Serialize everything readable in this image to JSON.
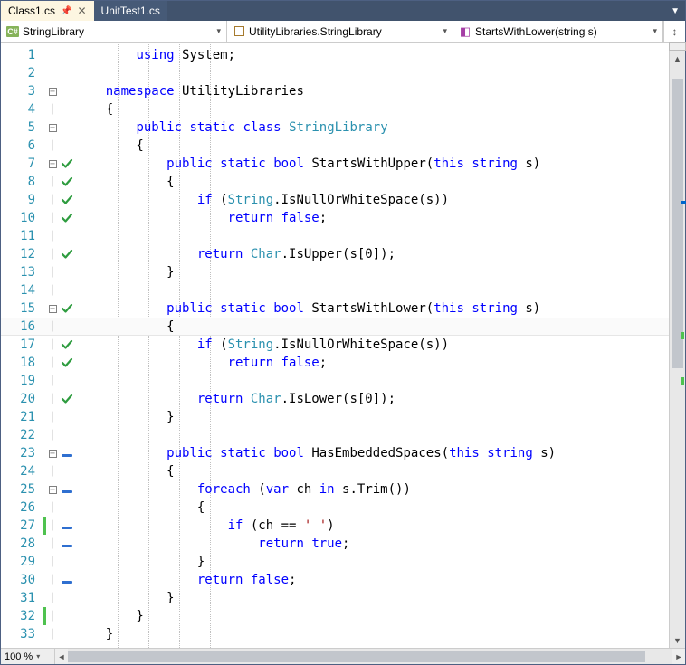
{
  "tabs": [
    {
      "label": "Class1.cs",
      "active": true
    },
    {
      "label": "UnitTest1.cs",
      "active": false
    }
  ],
  "nav": {
    "project": "StringLibrary",
    "class": "UtilityLibraries.StringLibrary",
    "member": "StartsWithLower(string s)"
  },
  "zoom": "100 %",
  "current_line": 16,
  "code": [
    {
      "n": 1,
      "fold": "",
      "mark": "",
      "chg": "",
      "tokens": [
        [
          "",
          "        "
        ],
        [
          "kw",
          "using"
        ],
        [
          "",
          " System;"
        ]
      ]
    },
    {
      "n": 2,
      "fold": "",
      "mark": "",
      "chg": "",
      "tokens": [
        [
          "",
          ""
        ]
      ]
    },
    {
      "n": 3,
      "fold": "box",
      "mark": "",
      "chg": "",
      "tokens": [
        [
          "",
          "    "
        ],
        [
          "kw",
          "namespace"
        ],
        [
          "",
          " UtilityLibraries"
        ]
      ]
    },
    {
      "n": 4,
      "fold": "",
      "mark": "",
      "chg": "",
      "tokens": [
        [
          "",
          "    {"
        ]
      ]
    },
    {
      "n": 5,
      "fold": "box",
      "mark": "",
      "chg": "",
      "tokens": [
        [
          "",
          "        "
        ],
        [
          "kw",
          "public"
        ],
        [
          "",
          " "
        ],
        [
          "kw",
          "static"
        ],
        [
          "",
          " "
        ],
        [
          "kw",
          "class"
        ],
        [
          "",
          " "
        ],
        [
          "type",
          "StringLibrary"
        ]
      ]
    },
    {
      "n": 6,
      "fold": "",
      "mark": "",
      "chg": "",
      "tokens": [
        [
          "",
          "        {"
        ]
      ]
    },
    {
      "n": 7,
      "fold": "box",
      "mark": "check",
      "chg": "",
      "tokens": [
        [
          "",
          "            "
        ],
        [
          "kw",
          "public"
        ],
        [
          "",
          " "
        ],
        [
          "kw",
          "static"
        ],
        [
          "",
          " "
        ],
        [
          "kw",
          "bool"
        ],
        [
          "",
          " StartsWithUpper("
        ],
        [
          "kw",
          "this"
        ],
        [
          "",
          " "
        ],
        [
          "kw",
          "string"
        ],
        [
          "",
          " s)"
        ]
      ]
    },
    {
      "n": 8,
      "fold": "",
      "mark": "check",
      "chg": "",
      "tokens": [
        [
          "",
          "            {"
        ]
      ]
    },
    {
      "n": 9,
      "fold": "",
      "mark": "check",
      "chg": "",
      "tokens": [
        [
          "",
          "                "
        ],
        [
          "kw",
          "if"
        ],
        [
          "",
          " ("
        ],
        [
          "type",
          "String"
        ],
        [
          "",
          ".IsNullOrWhiteSpace(s))"
        ]
      ]
    },
    {
      "n": 10,
      "fold": "",
      "mark": "check",
      "chg": "",
      "tokens": [
        [
          "",
          "                    "
        ],
        [
          "kw",
          "return"
        ],
        [
          "",
          " "
        ],
        [
          "kw",
          "false"
        ],
        [
          "",
          ";"
        ]
      ]
    },
    {
      "n": 11,
      "fold": "",
      "mark": "",
      "chg": "",
      "tokens": [
        [
          "",
          ""
        ]
      ]
    },
    {
      "n": 12,
      "fold": "",
      "mark": "check",
      "chg": "",
      "tokens": [
        [
          "",
          "                "
        ],
        [
          "kw",
          "return"
        ],
        [
          "",
          " "
        ],
        [
          "type",
          "Char"
        ],
        [
          "",
          ".IsUpper(s[0]);"
        ]
      ]
    },
    {
      "n": 13,
      "fold": "",
      "mark": "",
      "chg": "",
      "tokens": [
        [
          "",
          "            }"
        ]
      ]
    },
    {
      "n": 14,
      "fold": "",
      "mark": "",
      "chg": "",
      "tokens": [
        [
          "",
          ""
        ]
      ]
    },
    {
      "n": 15,
      "fold": "box",
      "mark": "check",
      "chg": "",
      "tokens": [
        [
          "",
          "            "
        ],
        [
          "kw",
          "public"
        ],
        [
          "",
          " "
        ],
        [
          "kw",
          "static"
        ],
        [
          "",
          " "
        ],
        [
          "kw",
          "bool"
        ],
        [
          "",
          " StartsWithLower("
        ],
        [
          "kw",
          "this"
        ],
        [
          "",
          " "
        ],
        [
          "kw",
          "string"
        ],
        [
          "",
          " s)"
        ]
      ]
    },
    {
      "n": 16,
      "fold": "",
      "mark": "",
      "chg": "",
      "tokens": [
        [
          "",
          "            {"
        ]
      ]
    },
    {
      "n": 17,
      "fold": "",
      "mark": "check",
      "chg": "",
      "tokens": [
        [
          "",
          "                "
        ],
        [
          "kw",
          "if"
        ],
        [
          "",
          " ("
        ],
        [
          "type",
          "String"
        ],
        [
          "",
          ".IsNullOrWhiteSpace(s))"
        ]
      ]
    },
    {
      "n": 18,
      "fold": "",
      "mark": "check",
      "chg": "",
      "tokens": [
        [
          "",
          "                    "
        ],
        [
          "kw",
          "return"
        ],
        [
          "",
          " "
        ],
        [
          "kw",
          "false"
        ],
        [
          "",
          ";"
        ]
      ]
    },
    {
      "n": 19,
      "fold": "",
      "mark": "",
      "chg": "",
      "tokens": [
        [
          "",
          ""
        ]
      ]
    },
    {
      "n": 20,
      "fold": "",
      "mark": "check",
      "chg": "",
      "tokens": [
        [
          "",
          "                "
        ],
        [
          "kw",
          "return"
        ],
        [
          "",
          " "
        ],
        [
          "type",
          "Char"
        ],
        [
          "",
          ".IsLower(s[0]);"
        ]
      ]
    },
    {
      "n": 21,
      "fold": "",
      "mark": "",
      "chg": "",
      "tokens": [
        [
          "",
          "            }"
        ]
      ]
    },
    {
      "n": 22,
      "fold": "",
      "mark": "",
      "chg": "",
      "tokens": [
        [
          "",
          ""
        ]
      ]
    },
    {
      "n": 23,
      "fold": "box",
      "mark": "dash",
      "chg": "",
      "tokens": [
        [
          "",
          "            "
        ],
        [
          "kw",
          "public"
        ],
        [
          "",
          " "
        ],
        [
          "kw",
          "static"
        ],
        [
          "",
          " "
        ],
        [
          "kw",
          "bool"
        ],
        [
          "",
          " HasEmbeddedSpaces("
        ],
        [
          "kw",
          "this"
        ],
        [
          "",
          " "
        ],
        [
          "kw",
          "string"
        ],
        [
          "",
          " s)"
        ]
      ]
    },
    {
      "n": 24,
      "fold": "",
      "mark": "",
      "chg": "",
      "tokens": [
        [
          "",
          "            {"
        ]
      ]
    },
    {
      "n": 25,
      "fold": "box",
      "mark": "dash",
      "chg": "",
      "tokens": [
        [
          "",
          "                "
        ],
        [
          "kw",
          "foreach"
        ],
        [
          "",
          " ("
        ],
        [
          "kw",
          "var"
        ],
        [
          "",
          " ch "
        ],
        [
          "kw",
          "in"
        ],
        [
          "",
          " s.Trim())"
        ]
      ]
    },
    {
      "n": 26,
      "fold": "",
      "mark": "",
      "chg": "",
      "tokens": [
        [
          "",
          "                {"
        ]
      ]
    },
    {
      "n": 27,
      "fold": "",
      "mark": "dash",
      "chg": "green",
      "tokens": [
        [
          "",
          "                    "
        ],
        [
          "kw",
          "if"
        ],
        [
          "",
          " (ch == "
        ],
        [
          "str",
          "' '"
        ],
        [
          "",
          ")"
        ]
      ]
    },
    {
      "n": 28,
      "fold": "",
      "mark": "dash",
      "chg": "",
      "tokens": [
        [
          "",
          "                        "
        ],
        [
          "kw",
          "return"
        ],
        [
          "",
          " "
        ],
        [
          "kw",
          "true"
        ],
        [
          "",
          ";"
        ]
      ]
    },
    {
      "n": 29,
      "fold": "",
      "mark": "",
      "chg": "",
      "tokens": [
        [
          "",
          "                }"
        ]
      ]
    },
    {
      "n": 30,
      "fold": "",
      "mark": "dash",
      "chg": "",
      "tokens": [
        [
          "",
          "                "
        ],
        [
          "kw",
          "return"
        ],
        [
          "",
          " "
        ],
        [
          "kw",
          "false"
        ],
        [
          "",
          ";"
        ]
      ]
    },
    {
      "n": 31,
      "fold": "",
      "mark": "",
      "chg": "",
      "tokens": [
        [
          "",
          "            }"
        ]
      ]
    },
    {
      "n": 32,
      "fold": "",
      "mark": "",
      "chg": "green",
      "tokens": [
        [
          "",
          "        }"
        ]
      ]
    },
    {
      "n": 33,
      "fold": "",
      "mark": "",
      "chg": "",
      "tokens": [
        [
          "",
          "    }"
        ]
      ]
    }
  ]
}
